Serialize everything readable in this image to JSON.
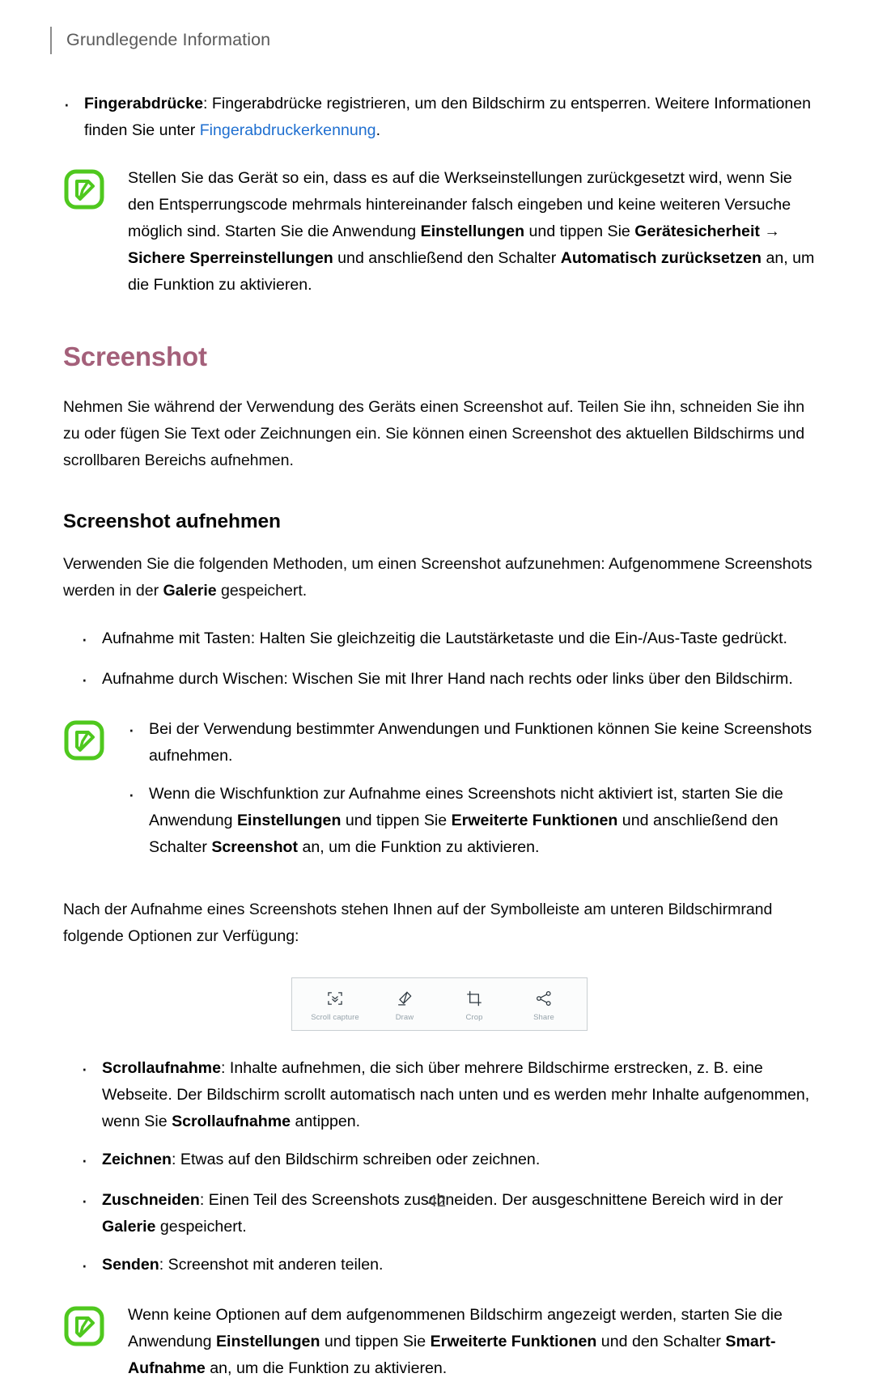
{
  "header": {
    "title": "Grundlegende Information"
  },
  "page_number": "42",
  "colors": {
    "heading_accent": "#a4607a",
    "link": "#1f6fd0",
    "note_icon": "#4fc81e",
    "toolbar_border": "#c9cfd2",
    "toolbar_label": "#96a3ab"
  },
  "fingerprint_bullet": {
    "term": "Fingerabdrücke",
    "colon": ": ",
    "text_before_link": "Fingerabdrücke registrieren, um den Bildschirm zu entsperren. Weitere Informationen finden Sie unter ",
    "link_text": "Fingerabdruckerkennung",
    "text_after_link": "."
  },
  "note_reset": {
    "icon": "note-pen-icon",
    "seg1": "Stellen Sie das Gerät so ein, dass es auf die Werkseinstellungen zurückgesetzt wird, wenn Sie den Entsperrungscode mehrmals hintereinander falsch eingeben und keine weiteren Versuche möglich sind. Starten Sie die Anwendung ",
    "bold1": "Einstellungen",
    "seg2": " und tippen Sie ",
    "bold2": "Gerätesicherheit →",
    "seg3": " ",
    "bold3": "Sichere Sperreinstellungen",
    "seg4": " und anschließend den Schalter ",
    "bold4": "Automatisch zurücksetzen",
    "seg5": " an, um die Funktion zu aktivieren."
  },
  "screenshot_section": {
    "heading": "Screenshot",
    "intro": "Nehmen Sie während der Verwendung des Geräts einen Screenshot auf. Teilen Sie ihn, schneiden Sie ihn zu oder fügen Sie Text oder Zeichnungen ein. Sie können einen Screenshot des aktuellen Bildschirms und scrollbaren Bereichs aufnehmen."
  },
  "capture_section": {
    "heading": "Screenshot aufnehmen",
    "intro_seg1": "Verwenden Sie die folgenden Methoden, um einen Screenshot aufzunehmen: Aufgenommene Screenshots werden in der ",
    "intro_bold": "Galerie",
    "intro_seg2": " gespeichert.",
    "methods": [
      "Aufnahme mit Tasten: Halten Sie gleichzeitig die Lautstärketaste und die Ein-/Aus-Taste gedrückt.",
      "Aufnahme durch Wischen: Wischen Sie mit Ihrer Hand nach rechts oder links über den Bildschirm."
    ]
  },
  "note_limitations": {
    "icon": "note-pen-icon",
    "bullet1": "Bei der Verwendung bestimmter Anwendungen und Funktionen können Sie keine Screenshots aufnehmen.",
    "bullet2": {
      "seg1": "Wenn die Wischfunktion zur Aufnahme eines Screenshots nicht aktiviert ist, starten Sie die Anwendung ",
      "bold1": "Einstellungen",
      "seg2": " und tippen Sie ",
      "bold2": "Erweiterte Funktionen",
      "seg3": " und anschließend den Schalter ",
      "bold3": "Screenshot",
      "seg4": " an, um die Funktion zu aktivieren."
    }
  },
  "toolbar_intro": "Nach der Aufnahme eines Screenshots stehen Ihnen auf der Symbolleiste am unteren Bildschirmrand folgende Optionen zur Verfügung:",
  "toolbar": {
    "items": [
      {
        "icon": "scroll-capture-icon",
        "label": "Scroll capture"
      },
      {
        "icon": "draw-pen-icon",
        "label": "Draw"
      },
      {
        "icon": "crop-icon",
        "label": "Crop"
      },
      {
        "icon": "share-icon",
        "label": "Share"
      }
    ]
  },
  "option_bullets": {
    "scroll": {
      "term": "Scrollaufnahme",
      "seg1": ": Inhalte aufnehmen, die sich über mehrere Bildschirme erstrecken, z. B. eine Webseite. Der Bildschirm scrollt automatisch nach unten und es werden mehr Inhalte aufgenommen, wenn Sie ",
      "bold2": "Scrollaufnahme",
      "seg2": " antippen."
    },
    "draw": {
      "term": "Zeichnen",
      "text": ": Etwas auf den Bildschirm schreiben oder zeichnen."
    },
    "crop": {
      "term": "Zuschneiden",
      "seg1": ": Einen Teil des Screenshots zuschneiden. Der ausgeschnittene Bereich wird in der ",
      "bold2": "Galerie",
      "seg2": " gespeichert."
    },
    "share": {
      "term": "Senden",
      "text": ": Screenshot mit anderen teilen."
    }
  },
  "note_smart_capture": {
    "icon": "note-pen-icon",
    "seg1": "Wenn keine Optionen auf dem aufgenommenen Bildschirm angezeigt werden, starten Sie die Anwendung ",
    "bold1": "Einstellungen",
    "seg2": " und tippen Sie ",
    "bold2": "Erweiterte Funktionen",
    "seg3": " und den Schalter ",
    "bold3": "Smart-Aufnahme",
    "seg4": " an, um die Funktion zu aktivieren."
  }
}
